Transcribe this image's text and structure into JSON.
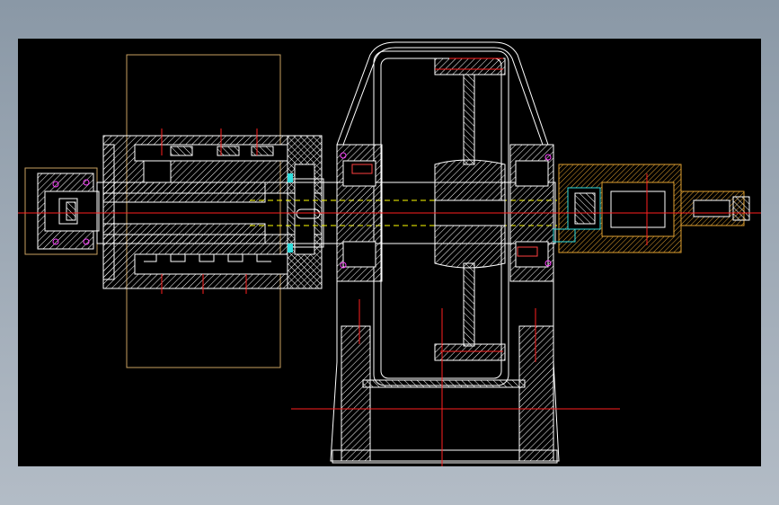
{
  "drawing": {
    "background": "#000000",
    "frame_bg": "#9aa6b2",
    "colors": {
      "outline": "#ffffff",
      "hatch": "#ffffff",
      "centerline": "#ff2020",
      "hidden_line": "#ffff00",
      "coupling": "#e0a030",
      "frame_rect": "#c8a060",
      "seal_cyan": "#30e0e0",
      "seal_magenta": "#ff40ff"
    }
  }
}
